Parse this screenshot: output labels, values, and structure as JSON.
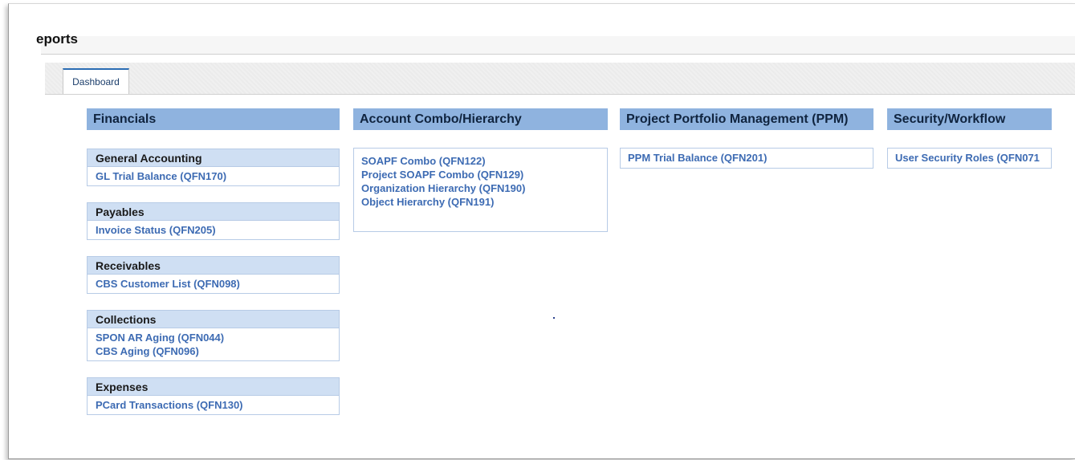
{
  "page": {
    "title": "eports"
  },
  "tabs": [
    {
      "label": "Dashboard",
      "active": true
    }
  ],
  "columns": [
    {
      "header": "Financials",
      "sections": [
        {
          "title": "General Accounting",
          "links": [
            "GL Trial Balance (QFN170)"
          ]
        },
        {
          "title": "Payables",
          "links": [
            "Invoice Status (QFN205)"
          ]
        },
        {
          "title": "Receivables",
          "links": [
            "CBS Customer List (QFN098)"
          ]
        },
        {
          "title": "Collections",
          "links": [
            "SPON AR Aging (QFN044)",
            "CBS Aging (QFN096)"
          ]
        },
        {
          "title": "Expenses",
          "links": [
            "PCard Transactions (QFN130)"
          ]
        }
      ]
    },
    {
      "header": "Account Combo/Hierarchy",
      "links": [
        "SOAPF Combo (QFN122)",
        "Project SOAPF Combo (QFN129)",
        "Organization Hierarchy (QFN190)",
        "Object Hierarchy (QFN191)"
      ]
    },
    {
      "header": "Project Portfolio Management (PPM)",
      "links": [
        "PPM Trial Balance (QFN201)"
      ]
    },
    {
      "header": "Security/Workflow",
      "links": [
        "User Security Roles (QFN071"
      ]
    }
  ],
  "colors": {
    "column_header_bg": "#8fb3df",
    "section_header_bg": "#cfdff3",
    "link": "#3d6bb3",
    "tab_accent": "#2a6cb3"
  }
}
